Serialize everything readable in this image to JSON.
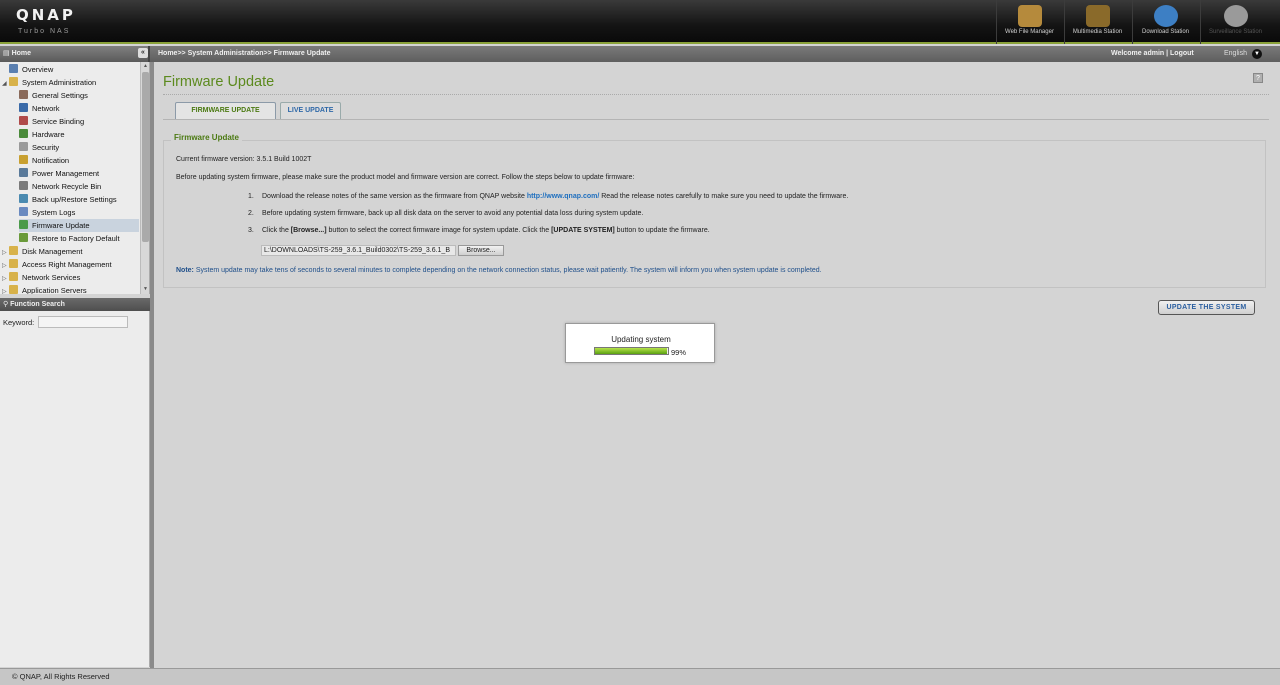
{
  "header": {
    "logo": "QNAP",
    "logo_sub": "Turbo NAS",
    "apps": [
      {
        "label": "Web File Manager",
        "icon": "folder-magnifier-icon",
        "color": "#b58a3c"
      },
      {
        "label": "Multimedia Station",
        "icon": "film-clapper-icon",
        "color": "#8a6a2a"
      },
      {
        "label": "Download Station",
        "icon": "globe-download-icon",
        "color": "#3d7fc4"
      },
      {
        "label": "Surveillance Station",
        "icon": "camera-dome-icon",
        "color": "#9a9a9a"
      }
    ]
  },
  "subbar": {
    "home": "Home",
    "breadcrumb": "Home>> System Administration>> Firmware Update",
    "welcome": "Welcome admin | Logout",
    "language": "English"
  },
  "sidebar": {
    "items": [
      {
        "label": "Overview",
        "level": 0,
        "icon": "#5a7fb0"
      },
      {
        "label": "System Administration",
        "level": 0,
        "icon": "#d8b24a",
        "expander": "◢"
      },
      {
        "label": "General Settings",
        "level": 1,
        "icon": "#8a6a5a"
      },
      {
        "label": "Network",
        "level": 1,
        "icon": "#3a6aa8"
      },
      {
        "label": "Service Binding",
        "level": 1,
        "icon": "#b04a4a"
      },
      {
        "label": "Hardware",
        "level": 1,
        "icon": "#4a8a3a"
      },
      {
        "label": "Security",
        "level": 1,
        "icon": "#9a9a9a"
      },
      {
        "label": "Notification",
        "level": 1,
        "icon": "#c8a030"
      },
      {
        "label": "Power Management",
        "level": 1,
        "icon": "#5a7a9a"
      },
      {
        "label": "Network Recycle Bin",
        "level": 1,
        "icon": "#7a7a7a"
      },
      {
        "label": "Back up/Restore Settings",
        "level": 1,
        "icon": "#4a8ab0"
      },
      {
        "label": "System Logs",
        "level": 1,
        "icon": "#6a8ac0"
      },
      {
        "label": "Firmware Update",
        "level": 1,
        "icon": "#4a9a4a",
        "selected": true
      },
      {
        "label": "Restore to Factory Default",
        "level": 1,
        "icon": "#6a9a3a"
      },
      {
        "label": "Disk Management",
        "level": 0,
        "icon": "#d8b24a",
        "expander": "▷"
      },
      {
        "label": "Access Right Management",
        "level": 0,
        "icon": "#d8b24a",
        "expander": "▷"
      },
      {
        "label": "Network Services",
        "level": 0,
        "icon": "#d8b24a",
        "expander": "▷"
      },
      {
        "label": "Application Servers",
        "level": 0,
        "icon": "#d8b24a",
        "expander": "▷"
      }
    ]
  },
  "function_search": {
    "title": "Function Search",
    "keyword_label": "Keyword:",
    "keyword_value": ""
  },
  "main": {
    "title": "Firmware Update",
    "tabs": [
      {
        "label": "FIRMWARE UPDATE",
        "active": true
      },
      {
        "label": "LIVE UPDATE",
        "active": false
      }
    ],
    "section_title": "Firmware Update",
    "current_version_label": "Current firmware version:",
    "current_version": "3.5.1 Build 1002T",
    "intro": "Before updating system firmware, please make sure the product model and firmware version are correct. Follow the steps below to update firmware:",
    "step1": {
      "num": "1.",
      "pre": "Download the release notes of the same version as the firmware from QNAP website ",
      "link": "http://www.qnap.com/",
      "post": " Read the release notes carefully to make sure you need to update the firmware."
    },
    "step2": {
      "num": "2.",
      "text": "Before updating system firmware, back up all disk data on the server to avoid any potential data loss during system update."
    },
    "step3": {
      "num": "3.",
      "pre": "Click the ",
      "b1": "[Browse...]",
      "mid": " button to select the correct firmware image for system update. Click the ",
      "b2": "[UPDATE SYSTEM]",
      "post": " button to update the firmware."
    },
    "file_path": "L:\\DOWNLOADS\\TS-259_3.6.1_Build0302\\TS-259_3.6.1_B",
    "browse_label": "Browse...",
    "note_label": "Note:",
    "note_text": " System update may take tens of seconds to several minutes to complete depending on the network connection status, please wait patiently. The system will inform you when system update is completed.",
    "update_button": "UPDATE THE SYSTEM"
  },
  "progress": {
    "title": "Updating system",
    "percent_value": 99,
    "percent_label": "99%"
  },
  "footer": {
    "copyright": "© QNAP, All Rights Reserved"
  }
}
